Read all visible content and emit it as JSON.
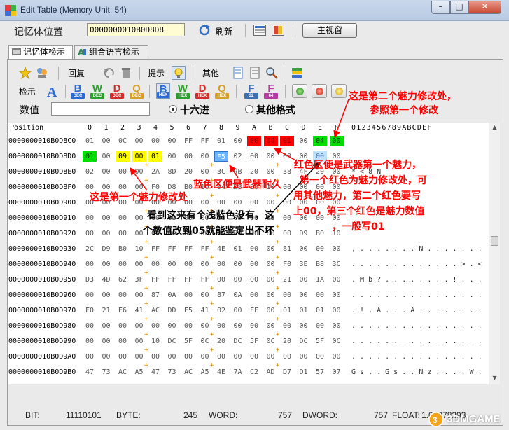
{
  "window": {
    "title": "Edit Table (Memory Unit: 54)",
    "close": "✕",
    "minimize": "–",
    "maximize": "□"
  },
  "addrbar": {
    "label": "记忆体位置",
    "address": "0000000010B0D8D8",
    "refresh": "刷新",
    "main_window": "主视窗"
  },
  "tabs": [
    {
      "label": "记忆体检示"
    },
    {
      "label": "组合语言检示"
    }
  ],
  "toolbar": {
    "replay": "回复",
    "hint": "提示",
    "other": "其他",
    "inspect": "检示",
    "letters": [
      {
        "ch": "B",
        "sub": "DEC",
        "color": "#2c6ad4"
      },
      {
        "ch": "W",
        "sub": "DEC",
        "color": "#2ca02c"
      },
      {
        "ch": "D",
        "sub": "DEC",
        "color": "#d42c2c"
      },
      {
        "ch": "Q",
        "sub": "DEC",
        "color": "#d4a02c"
      },
      {
        "ch": "B",
        "sub": "HEX",
        "color": "#2c6ad4"
      },
      {
        "ch": "W",
        "sub": "HEX",
        "color": "#2ca02c"
      },
      {
        "ch": "D",
        "sub": "HEX",
        "color": "#d42c2c"
      },
      {
        "ch": "Q",
        "sub": "HEX",
        "color": "#d4a02c"
      },
      {
        "ch": "F",
        "sub": "32",
        "color": "#3c6fb4"
      },
      {
        "ch": "F",
        "sub": "64",
        "color": "#b43ca0"
      }
    ]
  },
  "value": {
    "label": "数值",
    "input": "",
    "radio_hex": "十六进",
    "radio_other": "其他格式"
  },
  "grid": {
    "position_label": "Position",
    "columns": [
      "0",
      "1",
      "2",
      "3",
      "4",
      "5",
      "6",
      "7",
      "8",
      "9",
      "A",
      "B",
      "C",
      "D",
      "E",
      "F"
    ],
    "ascii_header": "0123456789ABCDEF",
    "rows": [
      {
        "addr": "0000000010B0D8C0",
        "cells": [
          "01",
          "00",
          "0C",
          "00",
          "00",
          "00",
          "FF",
          "FF",
          "01",
          "00",
          "00",
          "00",
          "01",
          "00",
          "04",
          "00"
        ],
        "ascii": ""
      },
      {
        "addr": "0000000010B0D8D0",
        "cells": [
          "01",
          "00",
          "09",
          "00",
          "01",
          "00",
          "00",
          "00",
          "F5",
          "02",
          "00",
          "00",
          "00",
          "00",
          "00",
          "00"
        ],
        "ascii": ""
      },
      {
        "addr": "0000000010B0D8E0",
        "cells": [
          "02",
          "00",
          "00",
          "00",
          "2A",
          "8D",
          "20",
          "00",
          "3C",
          "9B",
          "20",
          "00",
          "38",
          "4F",
          "20",
          "00"
        ],
        "ascii": "           *      <      8 N"
      },
      {
        "addr": "0000000010B0D8F0",
        "cells": [
          "00",
          "00",
          "00",
          "00",
          "F0",
          "D8",
          "B0",
          "10",
          "04",
          "D8",
          "B0",
          "10",
          "00",
          "00",
          "00",
          "00"
        ],
        "ascii": ""
      },
      {
        "addr": "0000000010B0D900",
        "cells": [
          "00",
          "00",
          "00",
          "00",
          "00",
          "00",
          "00",
          "00",
          "00",
          "00",
          "00",
          "00",
          "00",
          "00",
          "00",
          "00"
        ],
        "ascii": ""
      },
      {
        "addr": "0000000010B0D910",
        "cells": [
          "00",
          "00",
          "00",
          "00",
          "00",
          "00",
          "00",
          "00",
          "00",
          "00",
          "00",
          "00",
          "00",
          "00",
          "00",
          "00"
        ],
        "ascii": ""
      },
      {
        "addr": "0000000010B0D920",
        "cells": [
          "00",
          "00",
          "00",
          "00",
          "00",
          "00",
          "00",
          "00",
          "00",
          "00",
          "00",
          "00",
          "00",
          "D9",
          "B0",
          "10"
        ],
        "ascii": ""
      },
      {
        "addr": "0000000010B0D930",
        "cells": [
          "2C",
          "D9",
          "B0",
          "10",
          "FF",
          "FF",
          "FF",
          "FF",
          "4E",
          "01",
          "00",
          "00",
          "81",
          "00",
          "00",
          "00"
        ],
        "ascii": ",  . . . . . . . N . . . . . . ."
      },
      {
        "addr": "0000000010B0D940",
        "cells": [
          "00",
          "00",
          "00",
          "00",
          "00",
          "00",
          "00",
          "00",
          "00",
          "00",
          "00",
          "00",
          "F0",
          "3E",
          "B8",
          "3C"
        ],
        "ascii": ". . . . . . . . . . . . . > . <"
      },
      {
        "addr": "0000000010B0D950",
        "cells": [
          "D3",
          "4D",
          "62",
          "3F",
          "FF",
          "FF",
          "FF",
          "FF",
          "00",
          "00",
          "00",
          "00",
          "21",
          "00",
          "1A",
          "00"
        ],
        "ascii": ". M b ? . . . . . . . . ! . . ."
      },
      {
        "addr": "0000000010B0D960",
        "cells": [
          "00",
          "00",
          "00",
          "00",
          "87",
          "0A",
          "00",
          "00",
          "87",
          "0A",
          "00",
          "00",
          "00",
          "00",
          "00",
          "00"
        ],
        "ascii": ". . . . . . . . . . . . . . . ."
      },
      {
        "addr": "0000000010B0D970",
        "cells": [
          "F0",
          "21",
          "E6",
          "41",
          "AC",
          "DD",
          "E5",
          "41",
          "02",
          "00",
          "FF",
          "00",
          "01",
          "01",
          "01",
          "00"
        ],
        "ascii": ". ! . A . . . A . . . . . . . ."
      },
      {
        "addr": "0000000010B0D980",
        "cells": [
          "00",
          "00",
          "00",
          "00",
          "00",
          "00",
          "00",
          "00",
          "00",
          "00",
          "00",
          "00",
          "00",
          "00",
          "00",
          "00"
        ],
        "ascii": ". . . . . . . . . . . . . . . ."
      },
      {
        "addr": "0000000010B0D990",
        "cells": [
          "00",
          "00",
          "00",
          "00",
          "10",
          "DC",
          "5F",
          "0C",
          "20",
          "DC",
          "5F",
          "0C",
          "20",
          "DC",
          "5F",
          "0C"
        ],
        "ascii": ". . . . . . _ . . . _ . . . _ ."
      },
      {
        "addr": "0000000010B0D9A0",
        "cells": [
          "00",
          "00",
          "00",
          "00",
          "00",
          "00",
          "00",
          "00",
          "00",
          "00",
          "00",
          "00",
          "00",
          "00",
          "00",
          "00"
        ],
        "ascii": ". . . . . . . . . . . . . . . ."
      },
      {
        "addr": "0000000010B0D9B0",
        "cells": [
          "47",
          "73",
          "AC",
          "A5",
          "47",
          "73",
          "AC",
          "A5",
          "4E",
          "7A",
          "C2",
          "AD",
          "D7",
          "D1",
          "57",
          "07"
        ],
        "ascii": "G s . . G s . . N z . . . . W ."
      }
    ]
  },
  "status": {
    "bit_label": "BIT:",
    "bit": "11110101",
    "byte_label": "BYTE:",
    "byte": "245",
    "word_label": "WORD:",
    "word": "757",
    "dword_label": "DWORD:",
    "dword": "757",
    "float_label": "FLOAT:",
    "float": "1.06078293"
  },
  "annotations": {
    "second_charm_line1": "这是第二个魅力修改处，",
    "second_charm_line2": "参照第一个修改",
    "first_charm": "这是第一个魅力修改处",
    "red_zone_line1": "红色区便是武器第一个魅力，",
    "red_zone_line2": "第一个红色为魅力修改处，可",
    "red_zone_line3": "用其他魅力，第二个红色要写",
    "red_zone_line4": "上00，第三个红色是魅力数值",
    "red_zone_line5": "，一般写01",
    "blue_zone": "蓝色区便是武器耐久",
    "lightblue_line1": "看到这来有个浅蓝色没有，这",
    "lightblue_line2": "个数值改到05就能鉴定出不坏"
  },
  "watermark": "3DMGAME",
  "colors": {
    "highlight_red": "#ff0000",
    "highlight_green": "#00dd00",
    "highlight_yellow": "#ffff00",
    "highlight_blue": "#6cb4ff",
    "annotation_red": "#ff0000"
  }
}
